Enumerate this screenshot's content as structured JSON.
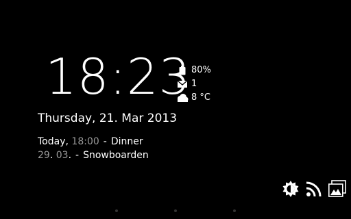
{
  "clock": {
    "time": "18:23"
  },
  "status": {
    "battery": {
      "icon": "battery-icon",
      "text": "80%"
    },
    "mail": {
      "icon": "mail-icon",
      "text": "1"
    },
    "weather": {
      "icon": "cloud-icon",
      "text": "8 °C"
    }
  },
  "date": {
    "text": "Thursday, 21. Mar 2013"
  },
  "events": [
    {
      "when_a": "Today,",
      "when_b": "18:00",
      "sep": "-",
      "title": "Dinner"
    },
    {
      "when_a": "29",
      "dot_a": ".",
      "when_b": "03",
      "dot_b": ".",
      "sep": "-",
      "title": "Snowboarden"
    }
  ],
  "actions": [
    {
      "name": "brightness-icon"
    },
    {
      "name": "rss-feed-icon"
    },
    {
      "name": "gallery-icon"
    }
  ],
  "colors": {
    "background": "#000000",
    "text": "#ffffff",
    "dim_text": "#9a9a9a"
  }
}
